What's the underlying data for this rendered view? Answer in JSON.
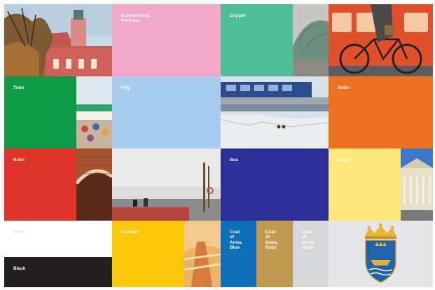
{
  "swatches": {
    "suomenlinna_fortress": {
      "label": "Suomenlinna\nFortress",
      "color": "#f1a7c8"
    },
    "copper": {
      "label": "Copper",
      "color": "#4fbf9a"
    },
    "tram": {
      "label": "Tram",
      "color": "#0e9a47"
    },
    "fog": {
      "label": "Fog",
      "color": "#a9cdee"
    },
    "metro": {
      "label": "Metro",
      "color": "#f07121"
    },
    "brick": {
      "label": "Brick",
      "color": "#e0332a"
    },
    "bus": {
      "label": "Bus",
      "color": "#2c2f96"
    },
    "engel": {
      "label": "Engel",
      "color": "#fde77a"
    },
    "white": {
      "label": "White",
      "color": "#ffffff"
    },
    "black": {
      "label": "Black",
      "color": "#231f20"
    },
    "summer": {
      "label": "Summer",
      "color": "#fbc70b"
    },
    "coat_of_arms_blue": {
      "label": "Coat\nof\nArms,\nBlue",
      "color": "#0d6fb8"
    },
    "coat_of_arms_gold": {
      "label": "Coat\nof\nArms,\nGold",
      "color": "#c29a50"
    },
    "coat_of_arms_silver": {
      "label": "Coat\nof\nArms,\nSilver",
      "color": "#d6d7d9"
    }
  },
  "photos": {
    "fortress": "fortress-photo",
    "dome": "copper-dome-photo",
    "bicycle": "metro-bicycle-photo",
    "tram": "tram-market-photo",
    "fog": "winter-bus-photo",
    "brick": "brick-arch-photo",
    "pier": "pier-fog-photo",
    "building": "engel-building-photo",
    "summer": "summer-photo",
    "crest": "helsinki-coat-of-arms"
  }
}
